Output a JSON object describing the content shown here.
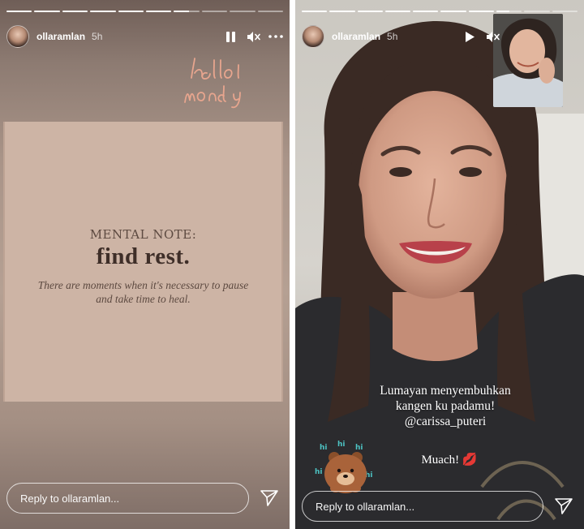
{
  "stories": [
    {
      "username": "ollaramlan",
      "time": "5h",
      "progress_segments": [
        1,
        1,
        1,
        1,
        1,
        1,
        0.6,
        0,
        0,
        0
      ],
      "sticker_text": "hello monday",
      "card": {
        "kicker": "MENTAL NOTE:",
        "headline": "find rest.",
        "note": "There are moments when it's necessary to pause and take time to heal."
      },
      "reply_placeholder": "Reply to ollaramlan...",
      "controls": {
        "pause": "pause-icon",
        "mute": "speaker-muted-icon",
        "more": "more-icon"
      }
    },
    {
      "username": "ollaramlan",
      "time": "5h",
      "progress_segments": [
        1,
        1,
        1,
        1,
        1,
        1,
        1,
        0.5,
        0,
        0
      ],
      "caption_line1": "Lumayan menyembuhkan",
      "caption_line2": "kangen ku padamu!",
      "mention": "@carissa_puteri",
      "muach": "Muach!",
      "bear_sticker_text": "hi hi hi",
      "reply_placeholder": "Reply to ollaramlan...",
      "controls": {
        "play": "play-icon",
        "mute": "speaker-muted-icon",
        "more": "more-icon"
      }
    }
  ],
  "colors": {
    "card": "#cdb4a5",
    "text_dark": "#3e2e28",
    "accent_sticker": "#e7a58e"
  }
}
